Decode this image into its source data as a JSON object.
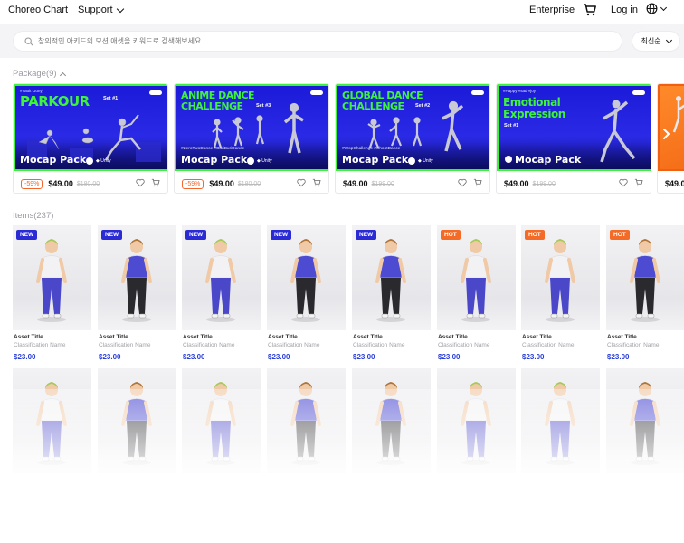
{
  "nav": {
    "logo": "Choreo Chart",
    "support": "Support",
    "enterprise": "Enterprise",
    "cart_icon": "cart-icon",
    "login": "Log in",
    "lang_icon": "globe-icon"
  },
  "search": {
    "placeholder": "창의적인 아키드의 모션 애셋을 키워드로 검색해보세요.",
    "sort_label": "최신순"
  },
  "packages": {
    "heading": "Package(9)",
    "cards": [
      {
        "tag": "#Vault (Juny)",
        "title": "PARKOUR",
        "set": "Set #1",
        "hashtags": "",
        "mocap": "Mocap Pack",
        "discount": "-59%",
        "price": "$49.00",
        "old_price": "$180.00"
      },
      {
        "tag": "",
        "title": "Anime DANCE CHALLENGE",
        "set": "Set #3",
        "hashtags": "#ZeroTwoDance #BuriBuriDance",
        "mocap": "Mocap Pack",
        "discount": "-59%",
        "price": "$49.00",
        "old_price": "$180.00"
      },
      {
        "tag": "",
        "title": "GLOBAL DANCE CHALLENGE",
        "set": "Set #2",
        "hashtags": "#WopChallenge #ShootDance",
        "mocap": "Mocap Pack",
        "discount": "",
        "price": "$49.00",
        "old_price": "$199.00"
      },
      {
        "tag": "#Happy #sad #joy",
        "title": "Emotional Expression",
        "set": "Set #1",
        "hashtags": "",
        "mocap": "Mocap Pack",
        "discount": "",
        "price": "$49.00",
        "old_price": "$199.00"
      },
      {
        "tag": "",
        "title": "",
        "set": "",
        "hashtags": "",
        "mocap": "",
        "discount": "",
        "price": "$49.0",
        "old_price": ""
      }
    ]
  },
  "items": {
    "heading": "Items(237)",
    "cards": [
      {
        "badge": "NEW",
        "title": "Asset Title",
        "sub": "Classification Name",
        "price": "$23.00"
      },
      {
        "badge": "NEW",
        "title": "Asset Title",
        "sub": "Classification Name",
        "price": "$23.00"
      },
      {
        "badge": "NEW",
        "title": "Asset Title",
        "sub": "Classification Name",
        "price": "$23.00"
      },
      {
        "badge": "NEW",
        "title": "Asset Title",
        "sub": "Classification Name",
        "price": "$23.00"
      },
      {
        "badge": "NEW",
        "title": "Asset Title",
        "sub": "Classification Name",
        "price": "$23.00"
      },
      {
        "badge": "HOT",
        "title": "Asset Title",
        "sub": "Classification Name",
        "price": "$23.00"
      },
      {
        "badge": "HOT",
        "title": "Asset Title",
        "sub": "Classification Name",
        "price": "$23.00"
      },
      {
        "badge": "HOT",
        "title": "Asset Title",
        "sub": "Classification Name",
        "price": "$23.00"
      }
    ]
  },
  "colors": {
    "brand_blue": "#2a3fd9",
    "banner_blue": "#2020dd",
    "neon_green": "#3ef23e",
    "discount_orange": "#f5662b",
    "hot_orange": "#f36b27"
  }
}
